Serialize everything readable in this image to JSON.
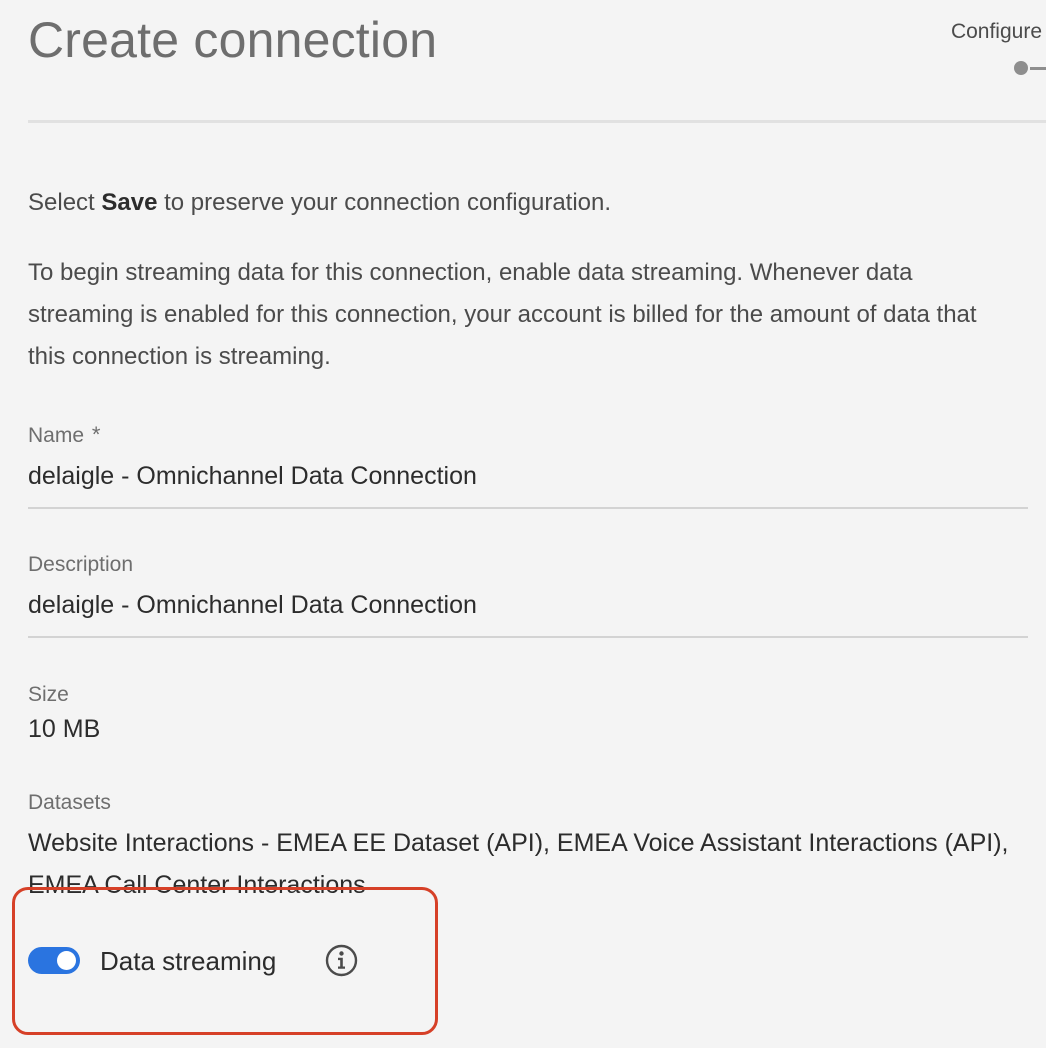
{
  "header": {
    "title": "Create connection",
    "step_label": "Configure"
  },
  "intro": {
    "prefix": "Select ",
    "bold": "Save",
    "suffix": " to preserve your connection configuration."
  },
  "streaming_notice": "To begin streaming data for this connection, enable data streaming. Whenever data streaming is enabled for this connection, your account is billed for the amount of data that this connection is streaming.",
  "fields": {
    "name": {
      "label": "Name",
      "required_marker": "*",
      "value": "delaigle - Omnichannel Data Connection"
    },
    "description": {
      "label": "Description",
      "value": "delaigle - Omnichannel Data Connection"
    },
    "size": {
      "label": "Size",
      "value": "10 MB"
    },
    "datasets": {
      "label": "Datasets",
      "value": "Website Interactions - EMEA EE Dataset (API), EMEA Voice Assistant Interactions (API), EMEA Call Center Interactions"
    }
  },
  "data_streaming": {
    "label": "Data streaming",
    "enabled": true,
    "info_icon": "info-icon"
  },
  "colors": {
    "toggle_on": "#2a74e0",
    "highlight_border": "#d64027",
    "background": "#f4f4f4"
  }
}
